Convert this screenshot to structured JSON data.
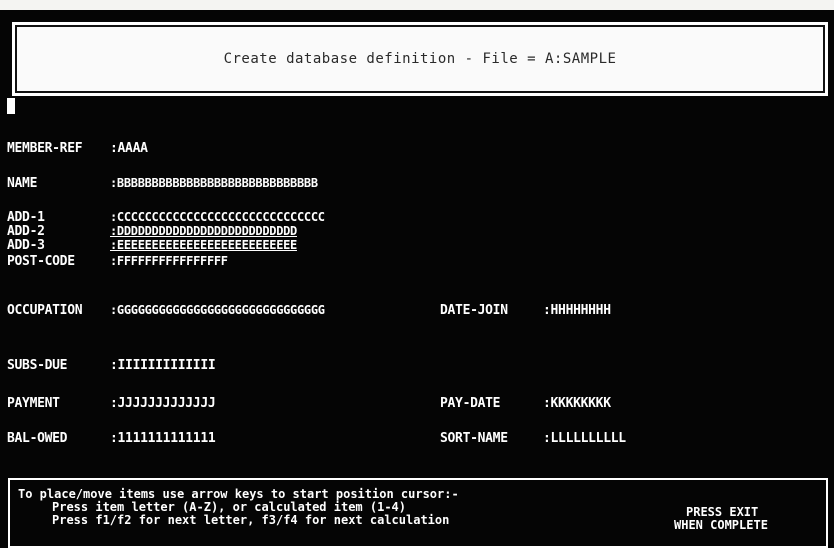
{
  "title": "Create database definition - File = A:SAMPLE",
  "fields": {
    "member_ref": {
      "label": "MEMBER-REF",
      "value": ":AAAA"
    },
    "name": {
      "label": "NAME",
      "value": ":BBBBBBBBBBBBBBBBBBBBBBBBBBBBB"
    },
    "add1": {
      "label": "ADD-1",
      "value": ":CCCCCCCCCCCCCCCCCCCCCCCCCCCCCC"
    },
    "add2": {
      "label": "ADD-2",
      "value": ":DDDDDDDDDDDDDDDDDDDDDDDDDD"
    },
    "add3": {
      "label": "ADD-3",
      "value": ":EEEEEEEEEEEEEEEEEEEEEEEEEE"
    },
    "post_code": {
      "label": "POST-CODE",
      "value": ":FFFFFFFFFFFFFFFF"
    },
    "occupation": {
      "label": "OCCUPATION",
      "value": ":GGGGGGGGGGGGGGGGGGGGGGGGGGGGGG"
    },
    "date_join": {
      "label": "DATE-JOIN",
      "value": ":HHHHHHHH"
    },
    "subs_due": {
      "label": "SUBS-DUE",
      "value": ":IIIIIIIIIIIII"
    },
    "payment": {
      "label": "PAYMENT",
      "value": ":JJJJJJJJJJJJJ"
    },
    "pay_date": {
      "label": "PAY-DATE",
      "value": ":KKKKKKKK"
    },
    "bal_owed": {
      "label": "BAL-OWED",
      "value": ":1111111111111"
    },
    "sort_name": {
      "label": "SORT-NAME",
      "value": ":LLLLLLLLLL"
    }
  },
  "help": {
    "line1": "To place/move items use arrow keys to start position cursor:-",
    "line2": "Press item letter (A-Z), or calculated item (1-4)",
    "line3": "Press f1/f2 for next letter, f3/f4 for next calculation",
    "exit1": "PRESS EXIT",
    "exit2": "WHEN COMPLETE"
  }
}
